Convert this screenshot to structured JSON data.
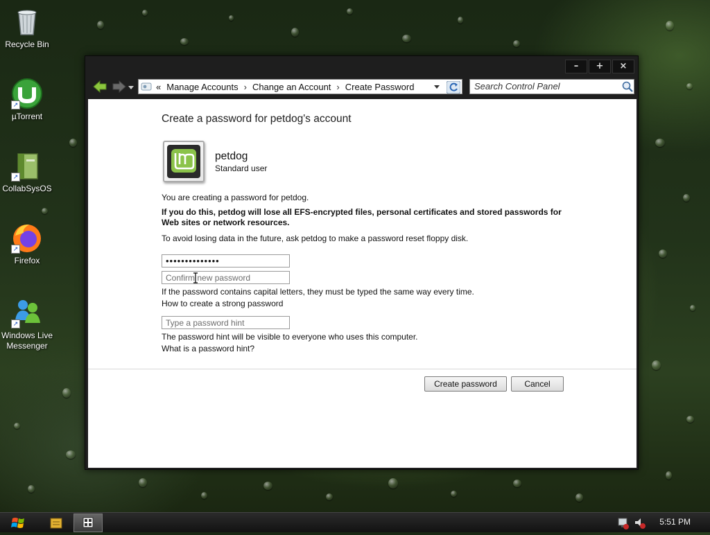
{
  "desktop": {
    "icons": [
      {
        "label": "Recycle Bin",
        "icon": "recycle-bin-icon"
      },
      {
        "label": "µTorrent",
        "icon": "utorrent-icon"
      },
      {
        "label": "CollabSysOS",
        "icon": "collabsysos-icon"
      },
      {
        "label": "Firefox",
        "icon": "firefox-icon"
      },
      {
        "label": "Windows Live\nMessenger",
        "icon": "messenger-icon"
      }
    ]
  },
  "window": {
    "controls": {
      "minimize": "–",
      "maximize": "+",
      "close": "×"
    },
    "address": {
      "prefix": "«",
      "crumbs": [
        "Manage Accounts",
        "Change an Account",
        "Create Password"
      ],
      "separator": "›"
    },
    "search": {
      "placeholder": "Search Control Panel"
    },
    "page": {
      "title": "Create a password for petdog's account",
      "account_name": "petdog",
      "account_type": "Standard user",
      "info_text": "You are creating a password for petdog.",
      "warning_text": "If you do this, petdog will lose all EFS-encrypted files, personal certificates and stored passwords for Web sites or network resources.",
      "advice_text": "To avoid losing data in the future, ask petdog to make a password reset floppy disk.",
      "password_value": "••••••••••••••",
      "confirm_placeholder": "Confirm new password",
      "capitals_note": "If the password contains capital letters, they must be typed the same way every time.",
      "strong_link": "How to create a strong password",
      "hint_placeholder": "Type a password hint",
      "hint_note": "The password hint will be visible to everyone who uses this computer.",
      "hint_link": "What is a password hint?",
      "create_button": "Create password",
      "cancel_button": "Cancel"
    }
  },
  "taskbar": {
    "clock": "5:51 PM"
  },
  "colors": {
    "accent_green": "#7cb342",
    "window_chrome": "#1e1e1e",
    "content_bg": "#ffffff"
  }
}
